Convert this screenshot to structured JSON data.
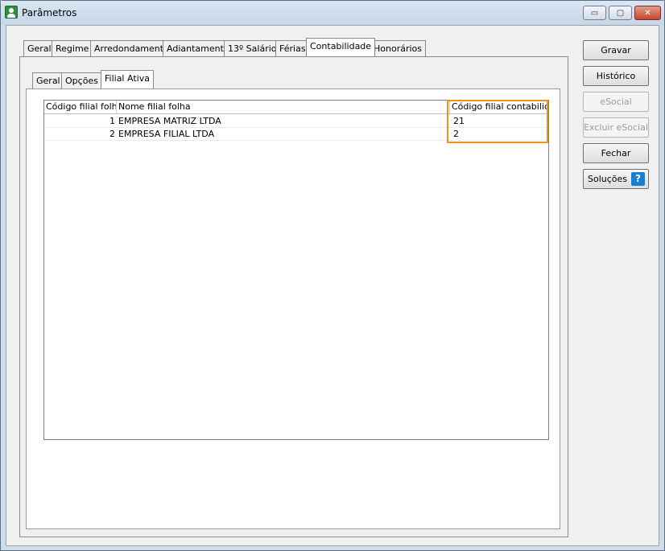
{
  "window": {
    "title": "Parâmetros",
    "minimize_glyph": "▭",
    "maximize_glyph": "▢",
    "close_glyph": "✕"
  },
  "tabs": [
    {
      "label": "Geral"
    },
    {
      "label": "Regime"
    },
    {
      "label": "Arredondamento"
    },
    {
      "label": "Adiantamento"
    },
    {
      "label": "13º Salário"
    },
    {
      "label": "Férias"
    },
    {
      "label": "Contabilidade"
    },
    {
      "label": "Honorários"
    }
  ],
  "active_tab": "Contabilidade",
  "subtabs": [
    {
      "label": "Geral"
    },
    {
      "label": "Opções"
    },
    {
      "label": "Filial Ativa"
    }
  ],
  "active_subtab": "Filial Ativa",
  "grid": {
    "columns": [
      "Código filial folha",
      "Nome filial folha",
      "Código filial contabilidade"
    ],
    "rows": [
      {
        "codigo": "1",
        "nome": "EMPRESA MATRIZ LTDA",
        "contabilidade": "21"
      },
      {
        "codigo": "2",
        "nome": "EMPRESA FILIAL LTDA",
        "contabilidade": "2"
      }
    ]
  },
  "buttons": {
    "gravar": "Gravar",
    "historico": "Histórico",
    "esocial": "eSocial",
    "excluir_esocial": "Excluir eSocial",
    "fechar": "Fechar",
    "solucoes": "Soluções",
    "help_glyph": "?"
  },
  "colors": {
    "highlight": "#f29117",
    "help_icon": "#1b7fd0",
    "app_icon": "#2f8f3e"
  }
}
